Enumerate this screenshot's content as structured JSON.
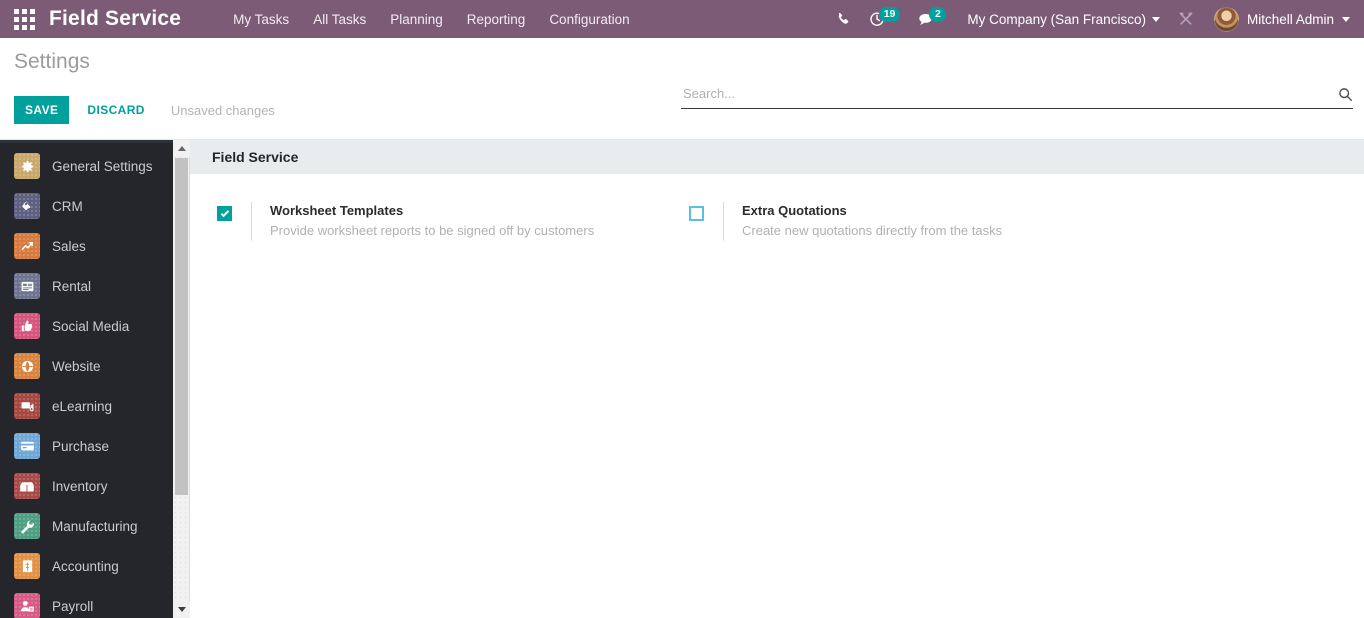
{
  "navbar": {
    "apps_icon": "apps-grid-icon",
    "brand": "Field Service",
    "menu": [
      {
        "label": "My Tasks"
      },
      {
        "label": "All Tasks"
      },
      {
        "label": "Planning"
      },
      {
        "label": "Reporting"
      },
      {
        "label": "Configuration"
      }
    ],
    "phone_icon": "phone-icon",
    "activities_icon": "clock-activity-icon",
    "activities_count": "19",
    "messages_icon": "chat-bubble-icon",
    "messages_count": "2",
    "company": "My Company (San Francisco)",
    "tools_icon": "developer-tools-icon",
    "avatar": "user-avatar",
    "user": "Mitchell Admin",
    "bg_color": "#7C5B76"
  },
  "control_panel": {
    "title": "Settings",
    "save_label": "SAVE",
    "discard_label": "DISCARD",
    "status": "Unsaved changes",
    "accent_color": "#00A09D"
  },
  "search": {
    "placeholder": "Search...",
    "value": "",
    "icon": "search-icon"
  },
  "sidebar": {
    "items": [
      {
        "label": "General Settings",
        "icon": "gear-icon",
        "glyph": "⚙",
        "color": "#C9A86A"
      },
      {
        "label": "CRM",
        "icon": "handshake-icon",
        "glyph": "♥",
        "color": "#5E6081"
      },
      {
        "label": "Sales",
        "icon": "chart-line-icon",
        "glyph": "↗",
        "color": "#D77B3E"
      },
      {
        "label": "Rental",
        "icon": "document-icon",
        "glyph": "▤",
        "color": "#6E7391"
      },
      {
        "label": "Social Media",
        "icon": "thumbs-up-icon",
        "glyph": "☝",
        "color": "#D6557E"
      },
      {
        "label": "Website",
        "icon": "globe-icon",
        "glyph": "◑",
        "color": "#D9833F"
      },
      {
        "label": "eLearning",
        "icon": "graduation-icon",
        "glyph": "▶",
        "color": "#A5483F"
      },
      {
        "label": "Purchase",
        "icon": "credit-card-icon",
        "glyph": "▭",
        "color": "#6FA8D6"
      },
      {
        "label": "Inventory",
        "icon": "box-icon",
        "glyph": "❐",
        "color": "#A84A47"
      },
      {
        "label": "Manufacturing",
        "icon": "wrench-icon",
        "glyph": "⚒",
        "color": "#4E9E83"
      },
      {
        "label": "Accounting",
        "icon": "invoice-icon",
        "glyph": "$",
        "color": "#E09145"
      },
      {
        "label": "Payroll",
        "icon": "user-badge-icon",
        "glyph": "☺",
        "color": "#D65A86"
      }
    ],
    "bg_color": "#25262B"
  },
  "scrollbar": {
    "up_arrow": "scroll-up-arrow",
    "down_arrow": "scroll-down-arrow",
    "thumb": "scroll-thumb"
  },
  "main": {
    "section_title": "Field Service",
    "settings": [
      {
        "label": "Worksheet Templates",
        "description": "Provide worksheet reports to be signed off by customers",
        "checked": true
      },
      {
        "label": "Extra Quotations",
        "description": "Create new quotations directly from the tasks",
        "checked": false
      }
    ]
  }
}
